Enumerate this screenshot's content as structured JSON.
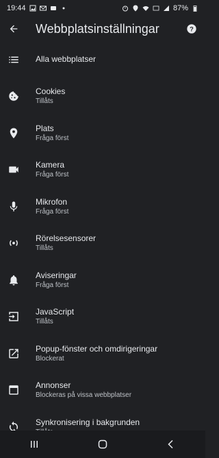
{
  "status_bar": {
    "time": "19:44",
    "battery": "87%",
    "icons_left": [
      "gallery-icon",
      "mail-icon",
      "voicemail-icon",
      "dot-icon"
    ],
    "icons_right": [
      "alarm-icon",
      "location-icon",
      "wifi-icon",
      "volte-icon",
      "signal-icon",
      "battery-icon"
    ]
  },
  "app_bar": {
    "title": "Webbplatsinställningar",
    "back_icon": "arrow-back-icon",
    "help_icon": "help-icon"
  },
  "settings": [
    {
      "icon": "list-icon",
      "title": "Alla webbplatser",
      "subtitle": ""
    },
    {
      "icon": "cookie-icon",
      "title": "Cookies",
      "subtitle": "Tillåts"
    },
    {
      "icon": "location-pin-icon",
      "title": "Plats",
      "subtitle": "Fråga först"
    },
    {
      "icon": "camera-icon",
      "title": "Kamera",
      "subtitle": "Fråga först"
    },
    {
      "icon": "microphone-icon",
      "title": "Mikrofon",
      "subtitle": "Fråga först"
    },
    {
      "icon": "motion-sensor-icon",
      "title": "Rörelsesensorer",
      "subtitle": "Tillåts"
    },
    {
      "icon": "bell-icon",
      "title": "Aviseringar",
      "subtitle": "Fråga först"
    },
    {
      "icon": "javascript-icon",
      "title": "JavaScript",
      "subtitle": "Tillåts"
    },
    {
      "icon": "popup-icon",
      "title": "Popup-fönster och omdirigeringar",
      "subtitle": "Blockerat"
    },
    {
      "icon": "ads-icon",
      "title": "Annonser",
      "subtitle": "Blockeras på vissa webbplatser"
    },
    {
      "icon": "sync-icon",
      "title": "Synkronisering i bakgrunden",
      "subtitle": "Tillåts"
    }
  ],
  "nav_bar": {
    "recents_icon": "recents-icon",
    "home_icon": "home-icon",
    "back_icon": "nav-back-icon"
  },
  "colors": {
    "background": "#202124",
    "text_primary": "#e8eaed",
    "text_secondary": "#bdc1c6",
    "nav_background": "#1a1b1e"
  }
}
